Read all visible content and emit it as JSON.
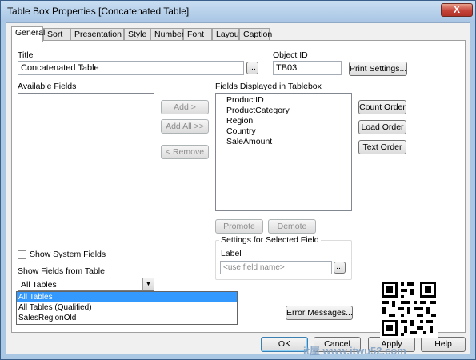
{
  "window": {
    "title": "Table Box Properties [Concatenated Table]",
    "close_glyph": "X"
  },
  "tabs": [
    "General",
    "Sort",
    "Presentation",
    "Style",
    "Number",
    "Font",
    "Layout",
    "Caption"
  ],
  "general": {
    "title_label": "Title",
    "title_value": "Concatenated Table",
    "ellipsis": "...",
    "object_id_label": "Object ID",
    "object_id_value": "TB03",
    "print_settings": "Print Settings...",
    "available_fields_label": "Available Fields",
    "fields_displayed_label": "Fields Displayed in Tablebox",
    "fields_displayed": [
      "ProductID",
      "ProductCategory",
      "Region",
      "Country",
      "SaleAmount"
    ],
    "add": "Add >",
    "add_all": "Add All >>",
    "remove": "< Remove",
    "count_order": "Count Order",
    "load_order": "Load Order",
    "text_order": "Text Order",
    "promote": "Promote",
    "demote": "Demote",
    "settings_group_label": "Settings for Selected Field",
    "label_label": "Label",
    "label_placeholder": "<use field name>",
    "show_system_fields": "Show System Fields",
    "show_fields_from_label": "Show Fields from Table",
    "show_fields_from_value": "All Tables",
    "dropdown_options": [
      "All Tables",
      "All Tables (Qualified)",
      "SalesRegionOld"
    ],
    "error_messages": "Error Messages..."
  },
  "footer": {
    "ok": "OK",
    "cancel": "Cancel",
    "apply": "Apply",
    "help": "Help"
  },
  "watermark": "it屋 www.itwu52.com"
}
